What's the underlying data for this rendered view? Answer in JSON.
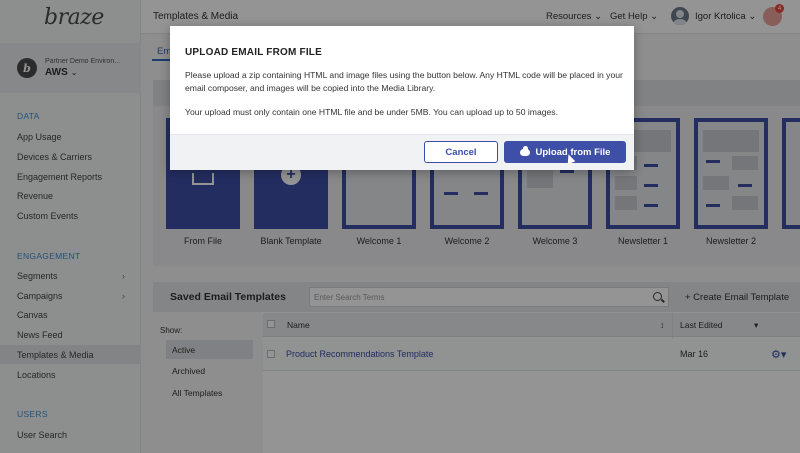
{
  "app": {
    "logo": "braze"
  },
  "org": {
    "name": "Partner Demo Environ...",
    "env": "AWS",
    "avatar_letter": "b"
  },
  "sidebar": {
    "sections": [
      {
        "title": "DATA",
        "items": [
          "App Usage",
          "Devices & Carriers",
          "Engagement Reports",
          "Revenue",
          "Custom Events"
        ]
      },
      {
        "title": "ENGAGEMENT",
        "items": [
          "Segments",
          "Campaigns",
          "Canvas",
          "News Feed",
          "Templates & Media",
          "Locations"
        ]
      },
      {
        "title": "USERS",
        "items": [
          "User Search"
        ]
      }
    ],
    "active": "Templates & Media"
  },
  "header": {
    "title": "Templates & Media",
    "resources": "Resources",
    "get_help": "Get Help",
    "user_name": "Igor Krtolica",
    "notification_count": "4"
  },
  "tabs": {
    "first_partial": "Em"
  },
  "gallery": {
    "cards": [
      "From File",
      "Blank Template",
      "Welcome 1",
      "Welcome 2",
      "Welcome 3",
      "Newsletter 1",
      "Newsletter 2"
    ]
  },
  "saved": {
    "title": "Saved Email Templates",
    "search_placeholder": "Enter Search Terms",
    "create_label": "+ Create Email Template",
    "show_label": "Show:",
    "filters": [
      "Active",
      "Archived",
      "All Templates"
    ],
    "columns": {
      "name": "Name",
      "last_edited": "Last Edited"
    },
    "rows": [
      {
        "name": "Product Recommendations Template",
        "last_edited": "Mar 16"
      }
    ]
  },
  "modal": {
    "title": "UPLOAD EMAIL FROM FILE",
    "p1": "Please upload a zip containing HTML and image files using the button below. Any HTML code will be placed in your email composer, and images will be copied into the Media Library.",
    "p2": "Your upload must only contain one HTML file and be under 5MB. You can upload up to 50 images.",
    "cancel": "Cancel",
    "upload": "Upload from File"
  },
  "colors": {
    "accent": "#3d4fa6",
    "link": "#3d8ed1"
  }
}
